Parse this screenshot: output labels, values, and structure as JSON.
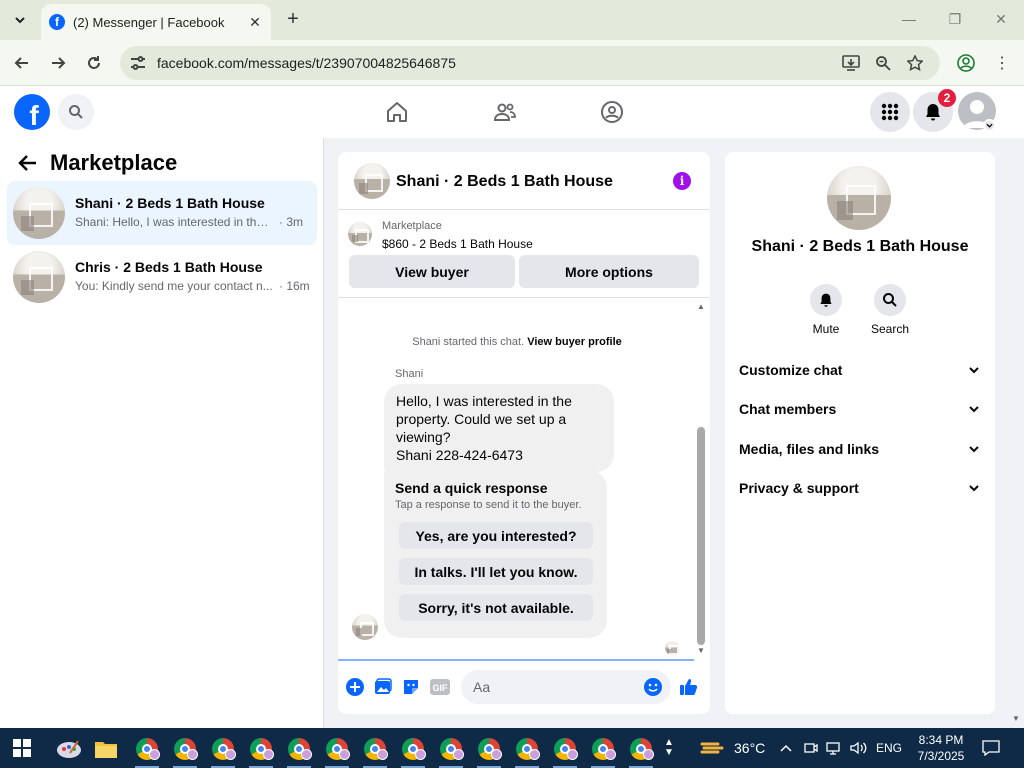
{
  "browser": {
    "tab_title": "(2) Messenger | Facebook",
    "url": "facebook.com/messages/t/23907004825646875"
  },
  "fb": {
    "notification_count": "2"
  },
  "left": {
    "title": "Marketplace",
    "conversations": [
      {
        "name": "Shani · 2 Beds 1 Bath House",
        "preview": "Shani: Hello, I was interested in the p...",
        "time": "· 3m",
        "active": true
      },
      {
        "name": "Chris · 2 Beds 1 Bath House",
        "preview": "You: Kindly send me your contact n...",
        "time": "· 16m",
        "active": false
      }
    ]
  },
  "chat": {
    "title": "Shani · 2 Beds 1 Bath House",
    "listing_category": "Marketplace",
    "listing_price": "$860 - 2 Beds 1 Bath House",
    "view_buyer": "View buyer",
    "more_options": "More options",
    "started_text": "Shani started this chat.",
    "view_profile": "View buyer profile",
    "sender": "Shani",
    "message_lines": [
      "Hello, I was interested in the",
      "property. Could we set up a",
      "viewing?",
      "Shani 228-424-6473"
    ],
    "quick_title": "Send a quick response",
    "quick_subtitle": "Tap a response to send it to the buyer.",
    "quick_replies": [
      "Yes, are you interested?",
      "In talks. I'll let you know.",
      "Sorry, it's not available."
    ],
    "placeholder": "Aa"
  },
  "right": {
    "name": "Shani · 2 Beds 1 Bath House",
    "mute": "Mute",
    "search": "Search",
    "sections": [
      "Customize chat",
      "Chat members",
      "Media, files and links",
      "Privacy & support"
    ]
  },
  "taskbar": {
    "weather": "36°C",
    "lang": "ENG",
    "time": "8:34 PM",
    "date": "7/3/2025"
  },
  "colors": {
    "fb_blue": "#0866ff",
    "info_purple": "#a010e8",
    "badge_red": "#e41e3f"
  }
}
